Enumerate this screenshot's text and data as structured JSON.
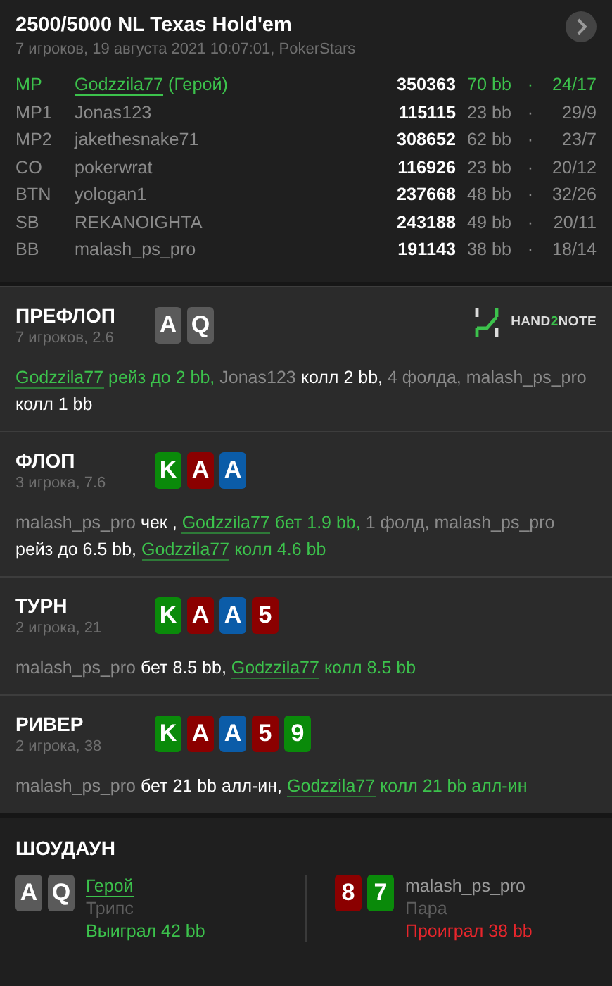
{
  "header": {
    "title": "2500/5000 NL Texas Hold'em",
    "subtitle": "7 игроков, 19 августа 2021 10:07:01, PokerStars"
  },
  "players": [
    {
      "position": "MP",
      "name": "Godzzila77",
      "hero_tag": "(Герой)",
      "hero": true,
      "stack": "350363",
      "bb": "70 bb",
      "sep": "·",
      "stat": "24/17"
    },
    {
      "position": "MP1",
      "name": "Jonas123",
      "hero": false,
      "stack": "115115",
      "bb": "23 bb",
      "sep": "·",
      "stat": "29/9"
    },
    {
      "position": "MP2",
      "name": "jakethesnake71",
      "hero": false,
      "stack": "308652",
      "bb": "62 bb",
      "sep": "·",
      "stat": "23/7"
    },
    {
      "position": "CO",
      "name": "pokerwrat",
      "hero": false,
      "stack": "116926",
      "bb": "23 bb",
      "sep": "·",
      "stat": "20/12"
    },
    {
      "position": "BTN",
      "name": "yologan1",
      "hero": false,
      "stack": "237668",
      "bb": "48 bb",
      "sep": "·",
      "stat": "32/26"
    },
    {
      "position": "SB",
      "name": "REKANOIGHTA",
      "hero": false,
      "stack": "243188",
      "bb": "49 bb",
      "sep": "·",
      "stat": "20/11"
    },
    {
      "position": "BB",
      "name": "malash_ps_pro",
      "hero": false,
      "stack": "191143",
      "bb": "38 bb",
      "sep": "·",
      "stat": "18/14"
    }
  ],
  "streets": [
    {
      "title": "ПРЕФЛОП",
      "subtitle": "7 игроков, 2.6",
      "logo": [
        "HAND",
        "2",
        "NOTE"
      ],
      "cards": [
        {
          "rank": "A",
          "color": "#5a5a5a"
        },
        {
          "rank": "Q",
          "color": "#5a5a5a"
        }
      ],
      "actions": [
        {
          "kind": "hero-link",
          "text": "Godzzila77"
        },
        {
          "kind": "hero",
          "text": "рейз до 2 bb,"
        },
        {
          "kind": "name",
          "text": "Jonas123"
        },
        {
          "kind": "act",
          "text": "колл 2 bb,"
        },
        {
          "kind": "name",
          "text": "4 фолда,"
        },
        {
          "kind": "name",
          "text": "malash_ps_pro"
        },
        {
          "kind": "act",
          "text": "колл 1 bb"
        }
      ]
    },
    {
      "title": "ФЛОП",
      "subtitle": "3 игрока, 7.6",
      "cards": [
        {
          "rank": "K",
          "color": "#0a8a0a"
        },
        {
          "rank": "A",
          "color": "#8b0000"
        },
        {
          "rank": "A",
          "color": "#0b5ca8"
        }
      ],
      "actions": [
        {
          "kind": "name",
          "text": "malash_ps_pro"
        },
        {
          "kind": "act",
          "text": "чек ,"
        },
        {
          "kind": "hero-link",
          "text": "Godzzila77"
        },
        {
          "kind": "hero",
          "text": "бет 1.9 bb,"
        },
        {
          "kind": "name",
          "text": "1 фолд,"
        },
        {
          "kind": "name",
          "text": "malash_ps_pro"
        },
        {
          "kind": "act",
          "text": "рейз до 6.5 bb,"
        },
        {
          "kind": "hero-link",
          "text": "Godzzila77"
        },
        {
          "kind": "hero",
          "text": "колл 4.6 bb"
        }
      ]
    },
    {
      "title": "ТУРН",
      "subtitle": "2 игрока, 21",
      "cards": [
        {
          "rank": "K",
          "color": "#0a8a0a"
        },
        {
          "rank": "A",
          "color": "#8b0000"
        },
        {
          "rank": "A",
          "color": "#0b5ca8"
        },
        {
          "rank": "5",
          "color": "#8b0000"
        }
      ],
      "actions": [
        {
          "kind": "name",
          "text": "malash_ps_pro"
        },
        {
          "kind": "act",
          "text": "бет 8.5 bb,"
        },
        {
          "kind": "hero-link",
          "text": "Godzzila77"
        },
        {
          "kind": "hero",
          "text": "колл 8.5 bb"
        }
      ]
    },
    {
      "title": "РИВЕР",
      "subtitle": "2 игрока, 38",
      "cards": [
        {
          "rank": "K",
          "color": "#0a8a0a"
        },
        {
          "rank": "A",
          "color": "#8b0000"
        },
        {
          "rank": "A",
          "color": "#0b5ca8"
        },
        {
          "rank": "5",
          "color": "#8b0000"
        },
        {
          "rank": "9",
          "color": "#0a8a0a"
        }
      ],
      "actions": [
        {
          "kind": "name",
          "text": "malash_ps_pro"
        },
        {
          "kind": "act",
          "text": "бет 21 bb алл-ин,"
        },
        {
          "kind": "hero-link",
          "text": "Godzzila77"
        },
        {
          "kind": "hero",
          "text": "колл 21 bb алл-ин"
        }
      ]
    }
  ],
  "showdown": {
    "title": "ШОУДАУН",
    "hands": [
      {
        "hero": true,
        "name": "Герой",
        "cards": [
          {
            "rank": "A",
            "color": "#5a5a5a"
          },
          {
            "rank": "Q",
            "color": "#5a5a5a"
          }
        ],
        "hand": "Трипс",
        "result": "Выиграл 42 bb",
        "won": true
      },
      {
        "hero": false,
        "name": "malash_ps_pro",
        "cards": [
          {
            "rank": "8",
            "color": "#8b0000"
          },
          {
            "rank": "7",
            "color": "#0a8a0a"
          }
        ],
        "hand": "Пара",
        "result": "Проиграл 38 bb",
        "won": false
      }
    ]
  }
}
